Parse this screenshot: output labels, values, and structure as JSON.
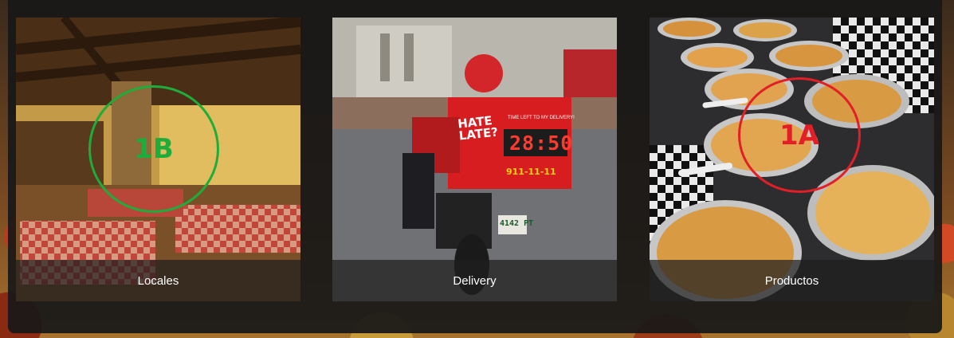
{
  "cards": [
    {
      "caption": "Locales",
      "annotation": {
        "label": "1B",
        "color": "#1ead3a"
      }
    },
    {
      "caption": "Delivery",
      "box": {
        "title": "HATE LATE?",
        "subtitle": "TIME LEFT TO MY DELIVERY!",
        "timer": "28:50",
        "phone": "911-11-11"
      },
      "plate": "4142 PT"
    },
    {
      "caption": "Productos",
      "annotation": {
        "label": "1A",
        "color": "#e21f26"
      }
    }
  ],
  "colors": {
    "panel": "#181818",
    "caption_bg": "#1e1e1e",
    "caption_text": "#ffffff"
  }
}
